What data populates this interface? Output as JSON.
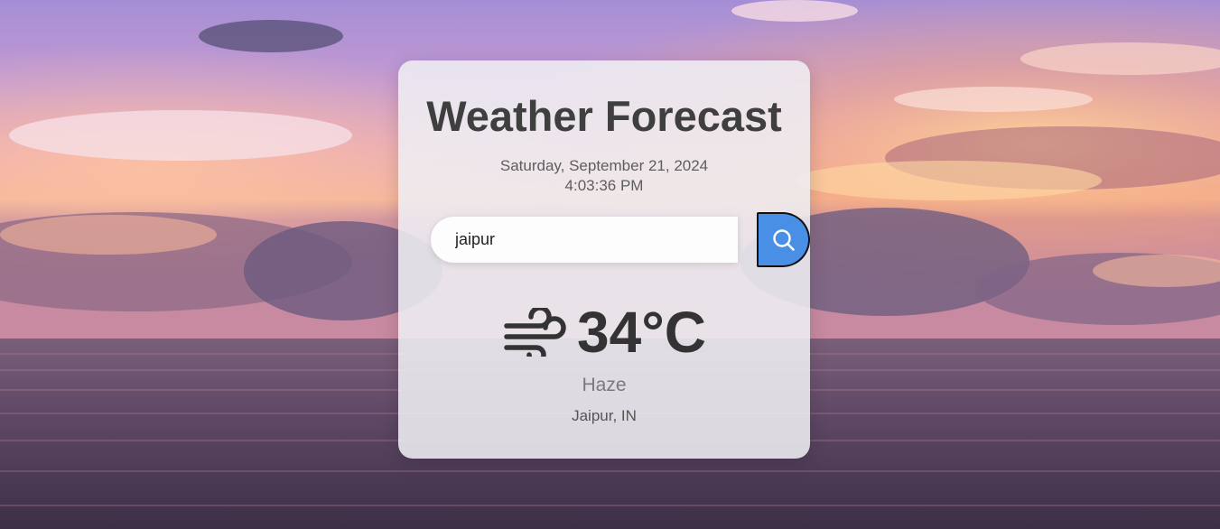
{
  "app": {
    "title": "Weather Forecast",
    "date": "Saturday, September 21, 2024",
    "time": "4:03:36 PM"
  },
  "search": {
    "value": "jaipur",
    "button_icon": "search-icon"
  },
  "weather": {
    "icon": "wind-icon",
    "temperature": "34°C",
    "condition": "Haze",
    "location": "Jaipur, IN"
  },
  "colors": {
    "accent": "#4a8fe6",
    "card": "#eeeef2",
    "title": "#3f3f3f"
  }
}
